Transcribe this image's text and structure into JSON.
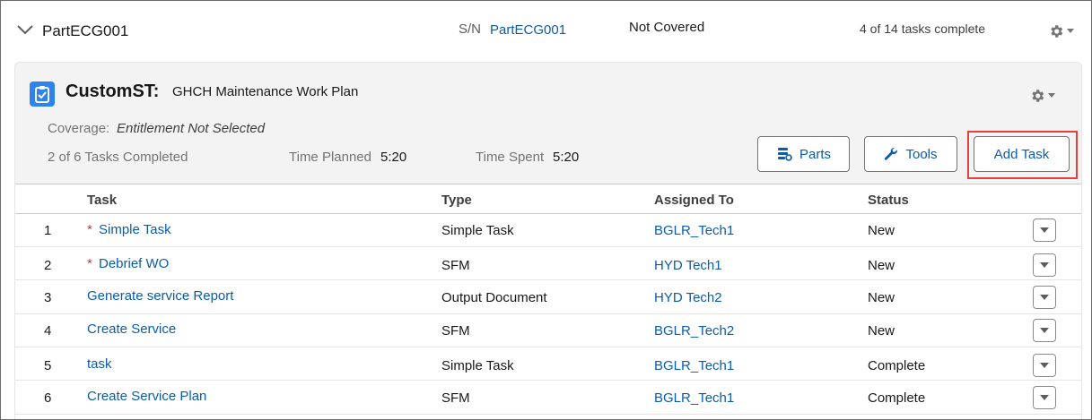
{
  "header": {
    "asset_name": "PartECG001",
    "sn_label": "S/N",
    "sn_value": "PartECG001",
    "coverage_status": "Not Covered",
    "tasks_progress": "4 of 14 tasks complete"
  },
  "workplan": {
    "title_bold": "CustomST:",
    "title_rest": "GHCH Maintenance Work Plan",
    "coverage_label": "Coverage:",
    "coverage_value": "Entitlement Not Selected",
    "tasks_completed": "2 of 6 Tasks Completed",
    "time_planned_label": "Time Planned",
    "time_planned_value": "5:20",
    "time_spent_label": "Time Spent",
    "time_spent_value": "5:20",
    "buttons": {
      "parts": "Parts",
      "tools": "Tools",
      "add_task": "Add Task"
    }
  },
  "table": {
    "columns": [
      "Task",
      "Type",
      "Assigned To",
      "Status"
    ],
    "rows": [
      {
        "num": "1",
        "required": "*",
        "task": "Simple Task",
        "type": "Simple Task",
        "assigned": "BGLR_Tech1",
        "status": "New"
      },
      {
        "num": "2",
        "required": "*",
        "task": "Debrief WO",
        "type": "SFM",
        "assigned": "HYD Tech1",
        "status": "New"
      },
      {
        "num": "3",
        "required": "",
        "task": "Generate service Report",
        "type": "Output Document",
        "assigned": "HYD Tech2",
        "status": "New"
      },
      {
        "num": "4",
        "required": "",
        "task": "Create Service",
        "type": "SFM",
        "assigned": "BGLR_Tech2",
        "status": "New"
      },
      {
        "num": "5",
        "required": "",
        "task": "task",
        "type": "Simple Task",
        "assigned": "BGLR_Tech1",
        "status": "Complete"
      },
      {
        "num": "6",
        "required": "",
        "task": "Create Service Plan",
        "type": "SFM",
        "assigned": "BGLR_Tech1",
        "status": "Complete"
      }
    ]
  },
  "colors": {
    "link": "#0b5cab",
    "highlight": "#e3413e",
    "icon_bg": "#2e84ec"
  }
}
